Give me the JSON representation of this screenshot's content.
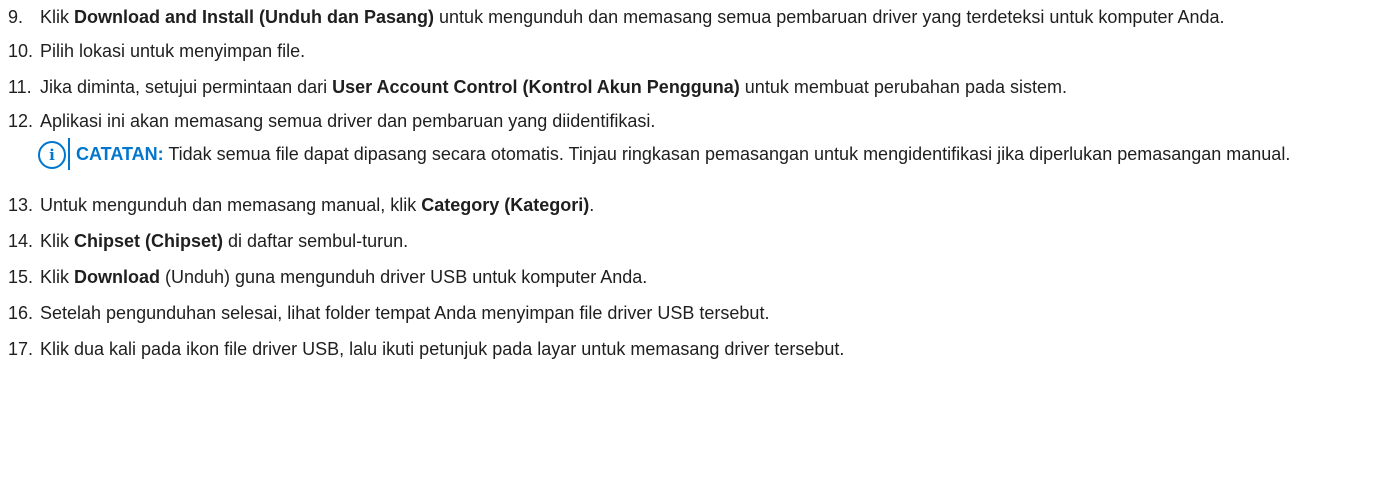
{
  "steps": [
    {
      "num": "9.",
      "pre": "Klik ",
      "bold": "Download and Install (Unduh dan Pasang)",
      "post": " untuk mengunduh dan memasang semua pembaruan driver yang terdeteksi untuk komputer Anda."
    },
    {
      "num": "10.",
      "text": "Pilih lokasi untuk menyimpan file."
    },
    {
      "num": "11.",
      "pre": "Jika diminta, setujui permintaan dari ",
      "bold": "User Account Control (Kontrol Akun Pengguna)",
      "post": " untuk membuat perubahan pada sistem."
    },
    {
      "num": "12.",
      "text": "Aplikasi ini akan memasang semua driver dan pembaruan yang diidentifikasi."
    },
    {
      "num": "13.",
      "pre": "Untuk mengunduh dan memasang manual, klik ",
      "bold": "Category (Kategori)",
      "post": "."
    },
    {
      "num": "14.",
      "pre": "Klik ",
      "bold": "Chipset (Chipset)",
      "post": " di daftar sembul-turun."
    },
    {
      "num": "15.",
      "pre": "Klik ",
      "bold": "Download",
      "post": " (Unduh) guna mengunduh driver USB untuk komputer Anda."
    },
    {
      "num": "16.",
      "text": "Setelah pengunduhan selesai, lihat folder tempat Anda menyimpan file driver USB tersebut."
    },
    {
      "num": "17.",
      "text": "Klik dua kali pada ikon file driver USB, lalu ikuti petunjuk pada layar untuk memasang driver tersebut."
    }
  ],
  "note": {
    "icon": "info-icon",
    "label": "CATATAN:",
    "text": " Tidak semua file dapat dipasang secara otomatis. Tinjau ringkasan pemasangan untuk mengidentifikasi jika diperlukan pemasangan manual."
  },
  "colors": {
    "accent": "#0076ce",
    "text": "#1f1f1f"
  }
}
